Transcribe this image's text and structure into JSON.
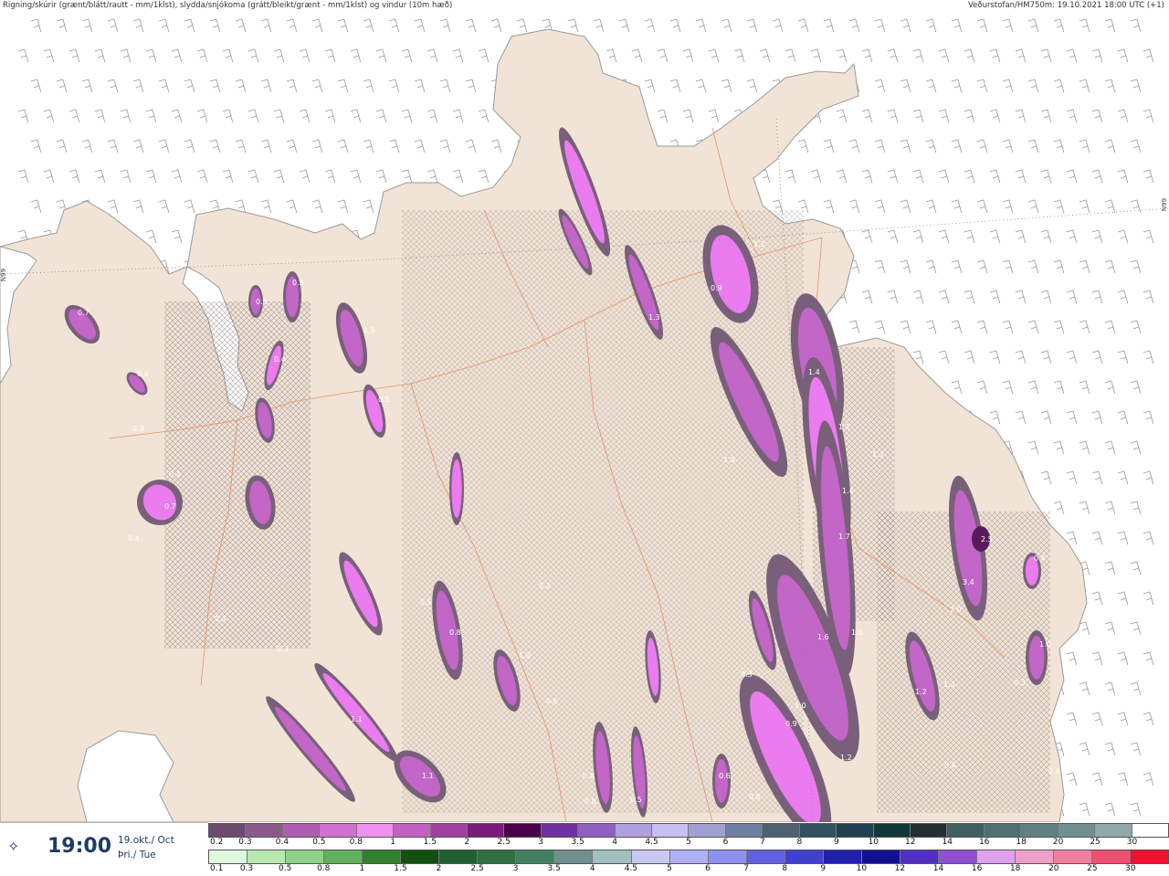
{
  "header": {
    "title": "Rigning/skúrir (grænt/blátt/rautt - mm/1klst), slydda/snjókoma (grátt/bleikt/grænt - mm/1klst) og vindur (10m hæð)",
    "source": "Veðurstofan/HM750m: 19.10.2021 18:00 UTC (+1)"
  },
  "grid_labels": {
    "left": "N99",
    "right": "N99"
  },
  "footer": {
    "time": "19:00",
    "date_line1": "19.okt./ Oct",
    "date_line2": "Þri./ Tue"
  },
  "scales": {
    "snow": {
      "labels": [
        "0.2",
        "0.3",
        "0.4",
        "0.5",
        "0.8",
        "1",
        "1.5",
        "2",
        "2.5",
        "3",
        "3.5",
        "4",
        "4.5",
        "5",
        "6",
        "7",
        "8",
        "9",
        "10",
        "12",
        "14",
        "16",
        "18",
        "20",
        "25",
        "30"
      ],
      "colors": [
        "#6e4a6e",
        "#8b5a8b",
        "#b05cb0",
        "#d070d0",
        "#f090f0",
        "#c060c0",
        "#a040a0",
        "#7a1a7a",
        "#4a004a",
        "#7030a0",
        "#9060c0",
        "#b0a0e0",
        "#c8c0f0",
        "#a0a0d0",
        "#7080a0",
        "#506070",
        "#305060",
        "#204050",
        "#103838",
        "#203030",
        "#406060",
        "#507070",
        "#608080",
        "#709090",
        "#90a8a8",
        "#ffffff"
      ]
    },
    "rain": {
      "labels": [
        "0.1",
        "0.3",
        "0.5",
        "0.8",
        "1",
        "1.5",
        "2",
        "2.5",
        "3",
        "3.5",
        "4",
        "4.5",
        "5",
        "6",
        "7",
        "8",
        "9",
        "10",
        "12",
        "14",
        "16",
        "18",
        "20",
        "25",
        "30"
      ],
      "colors": [
        "#e0f8e0",
        "#b8e8b0",
        "#90d088",
        "#60b060",
        "#308030",
        "#105010",
        "#206030",
        "#307040",
        "#408060",
        "#709090",
        "#a0c0c0",
        "#c8c8f0",
        "#b0b0f8",
        "#9090f0",
        "#6060e0",
        "#4040d0",
        "#2020b0",
        "#101090",
        "#5030c0",
        "#9050d0",
        "#e0a0f0",
        "#f0a0c8",
        "#f080a0",
        "#f05070",
        "#f01030"
      ]
    }
  },
  "map": {
    "colors": {
      "sea": "#ffffff",
      "land": "#f1e4d6",
      "coast": "#9a9a9a",
      "road": "#e8906a",
      "precip_light": "#7a5f7a",
      "precip_mid": "#c266c8",
      "precip_bright": "#ea7cf0",
      "precip_heavy": "#5a1a5a",
      "hatch": "#8a7a7a",
      "wind_barb": "#8a8a8a"
    },
    "value_labels": [
      "0.5",
      "0.5",
      "0.4",
      "0.4",
      "0.3",
      "1.5",
      "0.5",
      "0.4",
      "0.3",
      "1.3",
      "0.9",
      "1.2",
      "1.4",
      "0.6",
      "0.7",
      "1.9",
      "1.1",
      "1.4",
      "1.7",
      "1.3",
      "2.5",
      "3.4",
      "2.0",
      "1.6",
      "1.6",
      "1.0",
      "0.8",
      "1.0",
      "0.9",
      "1.2",
      "0.6",
      "0.8",
      "1.1",
      "1.1",
      "0.5",
      "0.8",
      "0.5",
      "0.7",
      "0.4",
      "0.3",
      "0.2",
      "0.3",
      "0.6",
      "1.2",
      "1.3",
      "0.4",
      "0.4",
      "1.0",
      "0.3",
      "0.8"
    ]
  }
}
